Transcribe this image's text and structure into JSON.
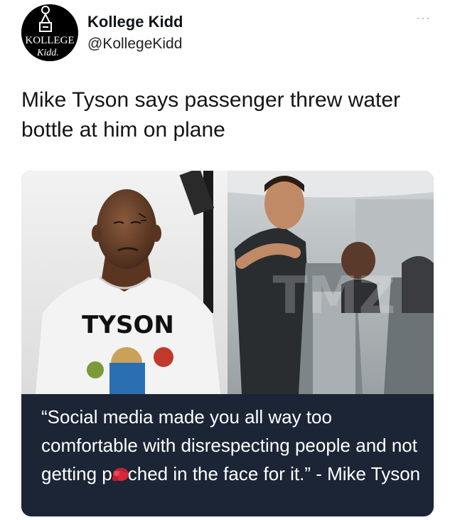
{
  "author": {
    "display_name": "Kollege Kidd",
    "handle": "@KollegeKidd",
    "avatar_text": "KOLLEGE Kidd",
    "more_label": "···"
  },
  "tweet": {
    "text": "Mike Tyson says passenger threw water bottle at him on plane"
  },
  "media": {
    "left_photo": {
      "shirt_text": "TYSON"
    },
    "right_photo": {
      "watermark": "TMZ"
    },
    "caption": {
      "part1": "“Social media made you all way too comfortable with disrespecting people and not getting p",
      "emoji": "boxing-glove-emoji",
      "part2": "ched in the face for it.” - Mike Tyson"
    }
  }
}
